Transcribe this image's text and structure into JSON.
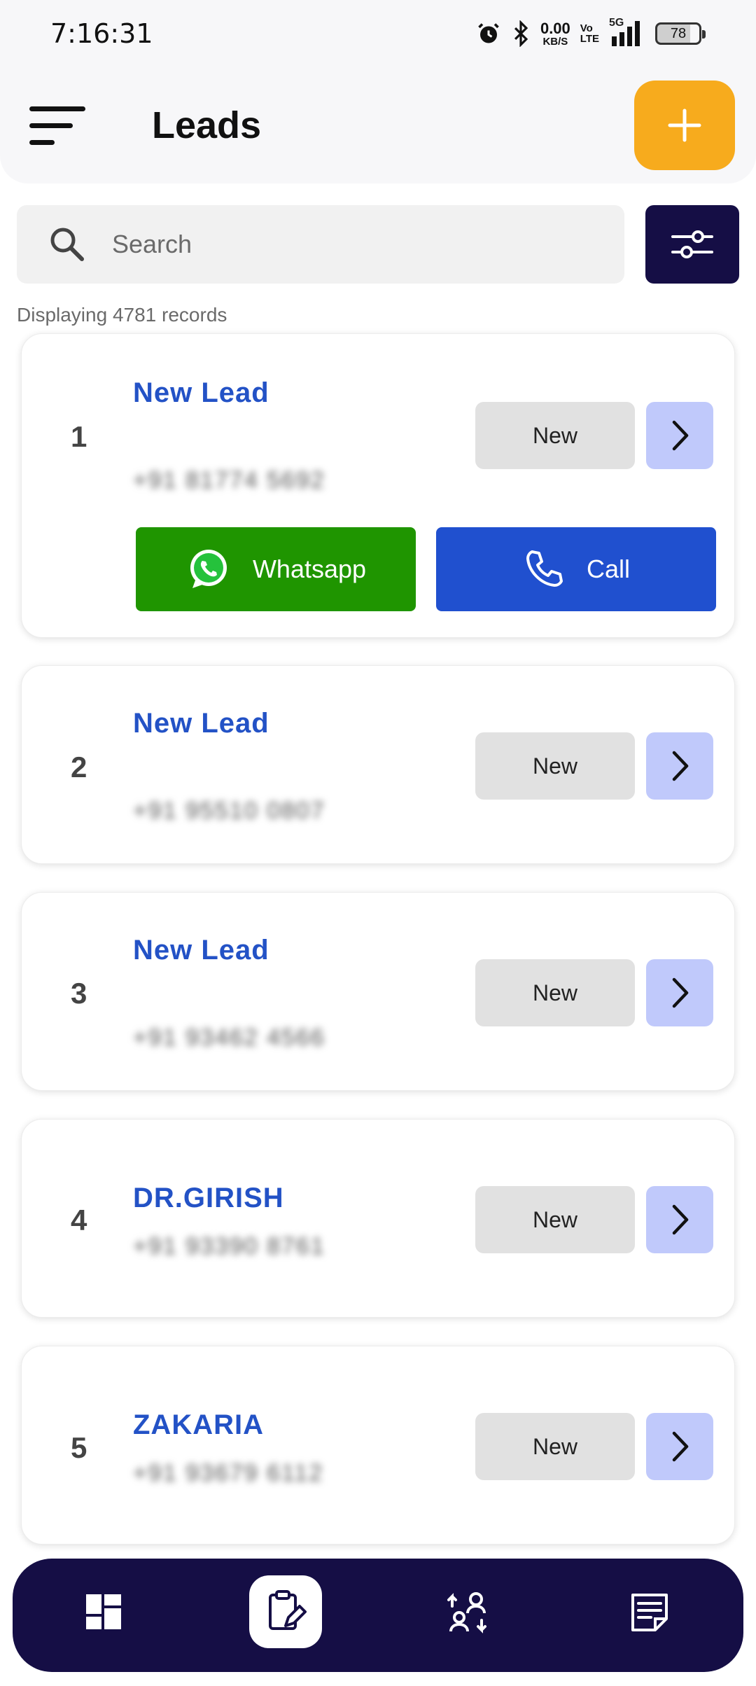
{
  "status_bar": {
    "time": "7:16:31",
    "net_speed_value": "0.00",
    "net_speed_unit": "KB/S",
    "volte_line1": "Vo",
    "volte_line2": "LTE",
    "network": "5G",
    "battery": "78"
  },
  "header": {
    "title": "Leads",
    "menu_icon": "menu-lines-icon",
    "add_icon": "plus-icon",
    "add_color": "#f7ab1d"
  },
  "search": {
    "placeholder": "Search",
    "filter_icon": "sliders-icon",
    "filter_color": "#150e45"
  },
  "records_text": "Displaying 4781 records",
  "leads": [
    {
      "index": "1",
      "name": "New Lead",
      "phone": "+91 81774 5692",
      "status": "New",
      "whatsapp_label": "Whatsapp",
      "call_label": "Call"
    },
    {
      "index": "2",
      "name": "New Lead",
      "phone": "+91 95510 0807",
      "status": "New"
    },
    {
      "index": "3",
      "name": "New Lead",
      "phone": "+91 93462 4566",
      "status": "New"
    },
    {
      "index": "4",
      "name": "DR.GIRISH",
      "phone": "+91 93390 8761",
      "status": "New"
    },
    {
      "index": "5",
      "name": "ZAKARIA",
      "phone": "+91 93679 6112",
      "status": "New"
    }
  ],
  "colors": {
    "lead_name": "#2352c6",
    "whatsapp": "#1f9500",
    "call": "#2050cf",
    "open_button": "#c0c9fb",
    "nav_bg": "#150e45"
  },
  "bottom_nav": {
    "items": [
      "dashboard-icon",
      "leads-clipboard-icon",
      "users-transfer-icon",
      "notes-icon"
    ],
    "active": "leads-clipboard-icon"
  }
}
